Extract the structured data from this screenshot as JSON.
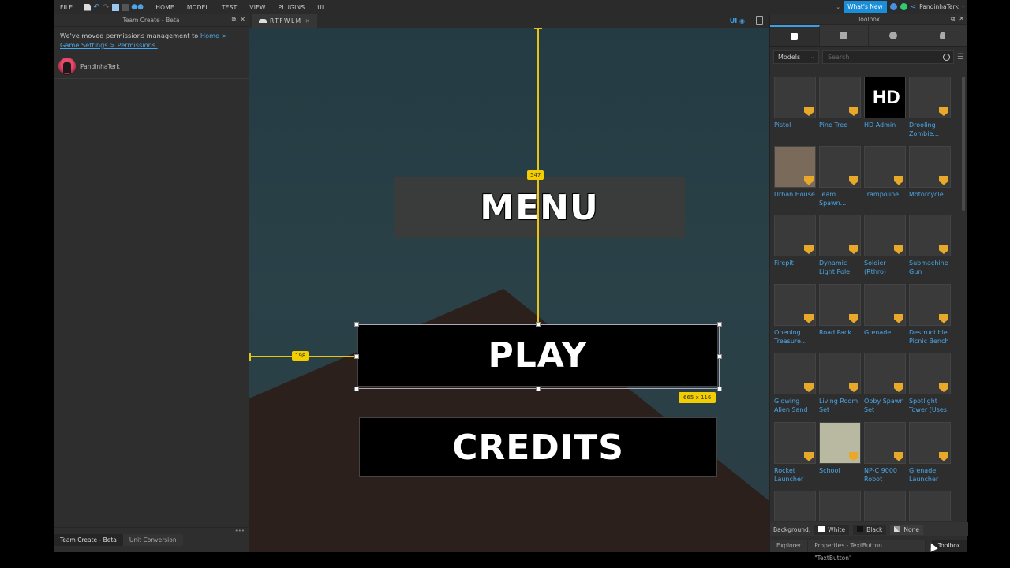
{
  "menubar": {
    "file": "FILE",
    "tabs": [
      "HOME",
      "MODEL",
      "TEST",
      "VIEW",
      "PLUGINS",
      "UI"
    ],
    "whats_new": "What's New",
    "username": "PandinhaTerk"
  },
  "left_panel": {
    "title": "Team Create - Beta",
    "notice_text": "We've moved permissions management to ",
    "notice_link": "Home > Game Settings > Permissions.",
    "user": "PandinhaTerk",
    "more": "•••",
    "tabs": [
      {
        "label": "Team Create - Beta",
        "active": true
      },
      {
        "label": "Unit Conversion",
        "active": false
      }
    ]
  },
  "center": {
    "doc_tab": "RTFWLM",
    "ui_toggle": "UI",
    "ui": {
      "menu_label": "MENU",
      "play_label": "PLAY",
      "credits_label": "CREDITS"
    },
    "guides": {
      "top_distance": "547",
      "left_distance": "198",
      "size": "665 x 116"
    }
  },
  "toolbox": {
    "title": "Toolbox",
    "tabs": [
      "marketplace",
      "inventory",
      "recent",
      "creations"
    ],
    "category": "Models",
    "search_placeholder": "Search",
    "items": [
      {
        "name": "Pistol",
        "thumb": "#3a3a3a"
      },
      {
        "name": "Pine Tree",
        "thumb": "#3a3a3a"
      },
      {
        "name": "HD Admin",
        "thumb": "#000000"
      },
      {
        "name": "Drooling Zombie...",
        "thumb": "#3a3a3a"
      },
      {
        "name": "Urban House",
        "thumb": "#7a6a5a"
      },
      {
        "name": "Team Spawn...",
        "thumb": "#3a3a3a"
      },
      {
        "name": "Trampoline",
        "thumb": "#3a3a3a"
      },
      {
        "name": "Motorcycle",
        "thumb": "#3a3a3a"
      },
      {
        "name": "Firepit",
        "thumb": "#3a3a3a"
      },
      {
        "name": "Dynamic Light Pole",
        "thumb": "#3a3a3a"
      },
      {
        "name": "Soldier (Rthro)",
        "thumb": "#3a3a3a"
      },
      {
        "name": "Submachine Gun",
        "thumb": "#3a3a3a"
      },
      {
        "name": "Opening Treasure...",
        "thumb": "#3a3a3a"
      },
      {
        "name": "Road Pack",
        "thumb": "#3a3a3a"
      },
      {
        "name": "Grenade",
        "thumb": "#3a3a3a"
      },
      {
        "name": "Destructible Picnic Bench",
        "thumb": "#3a3a3a"
      },
      {
        "name": "Glowing Alien Sand",
        "thumb": "#3a3a3a"
      },
      {
        "name": "Living Room Set",
        "thumb": "#3a3a3a"
      },
      {
        "name": "Obby Spawn Set",
        "thumb": "#3a3a3a"
      },
      {
        "name": "Spotlight Tower [Uses",
        "thumb": "#3a3a3a"
      },
      {
        "name": "Rocket Launcher",
        "thumb": "#3a3a3a"
      },
      {
        "name": "School",
        "thumb": "#b9b8a0"
      },
      {
        "name": "NP-C 9000 Robot",
        "thumb": "#3a3a3a"
      },
      {
        "name": "Grenade Launcher",
        "thumb": "#3a3a3a"
      },
      {
        "name": "",
        "thumb": "#3a3a3a"
      },
      {
        "name": "",
        "thumb": "#3a3a3a"
      },
      {
        "name": "",
        "thumb": "#3a3a3a"
      },
      {
        "name": "",
        "thumb": "#3a3a3a"
      }
    ],
    "background_label": "Background:",
    "background_options": [
      "White",
      "Black",
      "None"
    ],
    "bottom_tabs": [
      {
        "label": "Explorer",
        "active": false
      },
      {
        "label": "Properties - TextButton \"TextButton\"",
        "active": false
      },
      {
        "label": "Toolbox",
        "active": true
      }
    ]
  },
  "colors": {
    "accent": "#1b8ed9",
    "link": "#4aa6e8",
    "guide": "#f2cd00",
    "shield": "#e8a92a"
  }
}
